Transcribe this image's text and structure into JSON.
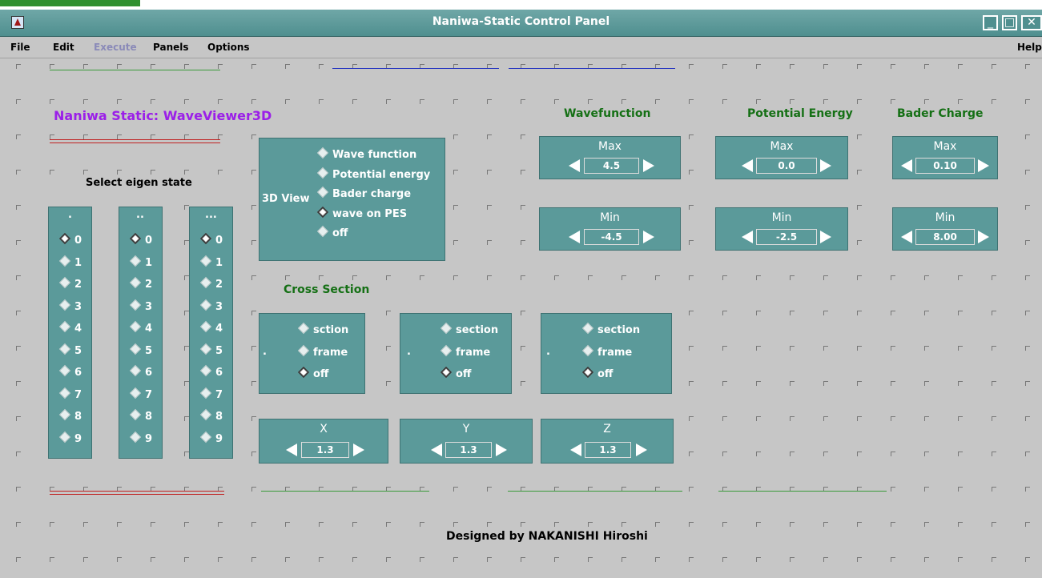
{
  "window": {
    "title": "Naniwa-Static Control Panel"
  },
  "menubar": {
    "file": "File",
    "edit": "Edit",
    "execute": "Execute",
    "panels": "Panels",
    "options": "Options",
    "help": "Help"
  },
  "app_title": "Naniwa Static: WaveViewer3D",
  "eigen": {
    "label": "Select eigen state",
    "columns": [
      {
        "header": ".",
        "options": [
          "0",
          "1",
          "2",
          "3",
          "4",
          "5",
          "6",
          "7",
          "8",
          "9"
        ],
        "selected": "0"
      },
      {
        "header": "..",
        "options": [
          "0",
          "1",
          "2",
          "3",
          "4",
          "5",
          "6",
          "7",
          "8",
          "9"
        ],
        "selected": "0"
      },
      {
        "header": "...",
        "options": [
          "0",
          "1",
          "2",
          "3",
          "4",
          "5",
          "6",
          "7",
          "8",
          "9"
        ],
        "selected": "0"
      }
    ]
  },
  "view3d": {
    "label": "3D View",
    "options": [
      "Wave function",
      "Potential energy",
      "Bader charge",
      "wave on PES",
      "off"
    ],
    "selected": "wave on PES"
  },
  "cross_section": {
    "title": "Cross Section",
    "groups": [
      {
        "prefix": ".",
        "options": [
          "sction",
          "frame",
          "off"
        ],
        "selected": "off"
      },
      {
        "prefix": ".",
        "options": [
          "section",
          "frame",
          "off"
        ],
        "selected": "off"
      },
      {
        "prefix": ".",
        "options": [
          "section",
          "frame",
          "off"
        ],
        "selected": "off"
      }
    ]
  },
  "axes": [
    {
      "label": "X",
      "value": "1.3"
    },
    {
      "label": "Y",
      "value": "1.3"
    },
    {
      "label": "Z",
      "value": "1.3"
    }
  ],
  "ranges": [
    {
      "title": "Wavefunction",
      "max": "4.5",
      "min": "-4.5"
    },
    {
      "title": "Potential Energy",
      "max": "0.0",
      "min": "-2.5"
    },
    {
      "title": "Bader Charge",
      "max": "0.10",
      "min": "8.00"
    }
  ],
  "labels": {
    "max": "Max",
    "min": "Min"
  },
  "footer": "Designed by NAKANISHI Hiroshi",
  "colors": {
    "teal": "#5b9a9a",
    "title_purple": "#9b1fe8",
    "header_green": "#157015"
  }
}
